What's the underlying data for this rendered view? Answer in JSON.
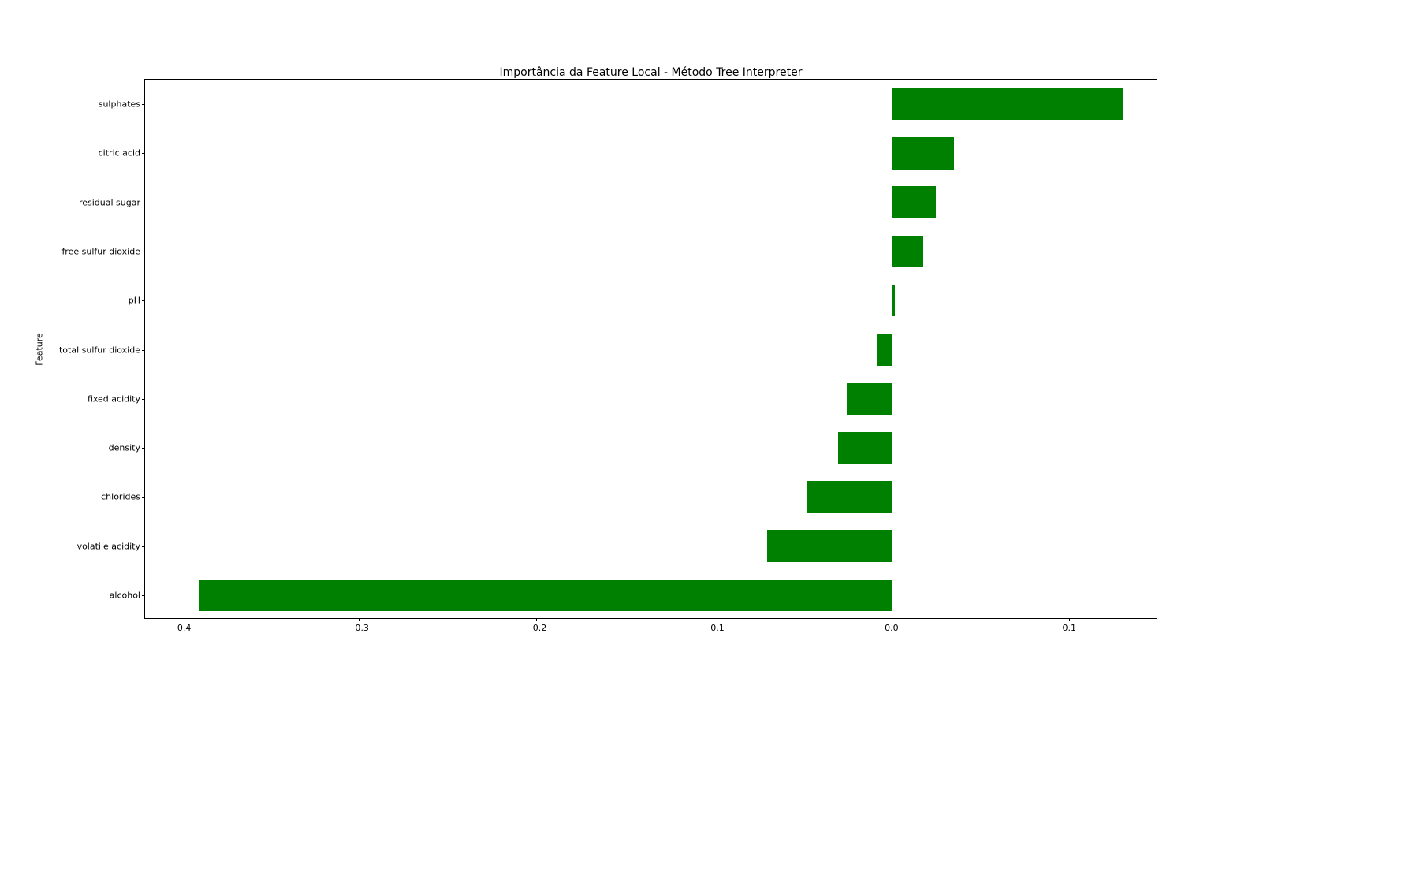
{
  "chart_data": {
    "type": "bar",
    "orientation": "horizontal",
    "title": "Importância da Feature Local - Método Tree Interpreter",
    "ylabel": "Feature",
    "xlabel": "",
    "xlim": [
      -0.42,
      0.15
    ],
    "x_ticks": [
      -0.4,
      -0.3,
      -0.2,
      -0.1,
      0.0,
      0.1
    ],
    "x_tick_labels": [
      "−0.4",
      "−0.3",
      "−0.2",
      "−0.1",
      "0.0",
      "0.1"
    ],
    "categories": [
      "sulphates",
      "citric acid",
      "residual sugar",
      "free sulfur dioxide",
      "pH",
      "total sulfur dioxide",
      "fixed acidity",
      "density",
      "chlorides",
      "volatile acidity",
      "alcohol"
    ],
    "values": [
      0.13,
      0.035,
      0.025,
      0.018,
      0.002,
      -0.008,
      -0.025,
      -0.03,
      -0.048,
      -0.07,
      -0.39
    ],
    "color": "#008000"
  }
}
